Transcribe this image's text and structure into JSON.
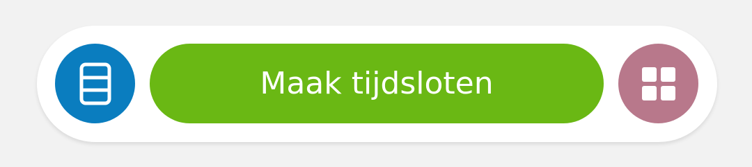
{
  "toolbar": {
    "list_button": {
      "icon": "list-view-icon",
      "color": "#0a7dbf"
    },
    "create_button": {
      "label": "Maak tijdsloten",
      "color": "#6ab814"
    },
    "grid_button": {
      "icon": "grid-view-icon",
      "color": "#b8788b"
    }
  }
}
